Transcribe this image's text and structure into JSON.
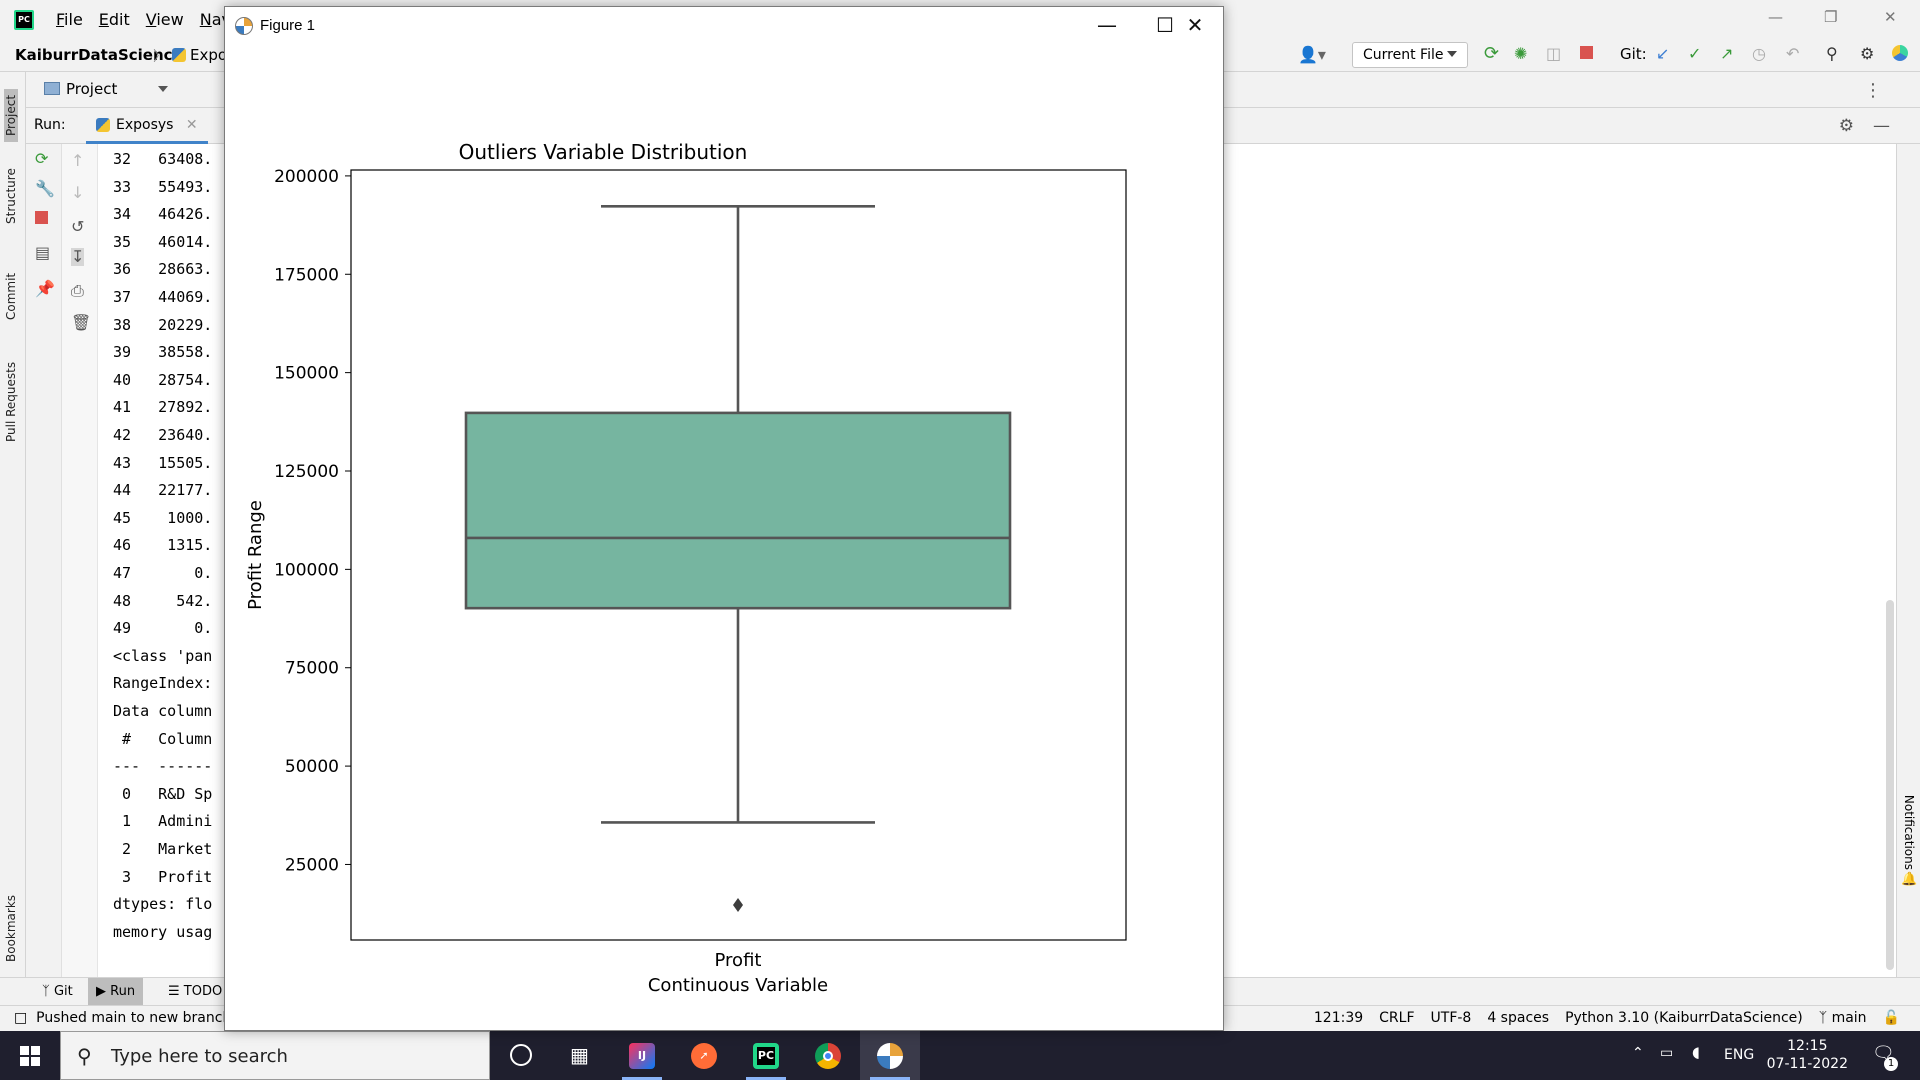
{
  "ide": {
    "menu": [
      "File",
      "Edit",
      "View",
      "Navig"
    ],
    "project_name": "KaiburrDataScience",
    "file_crumb": "Expo",
    "project_panel_label": "Project",
    "run_label": "Run:",
    "run_tab": "Exposys",
    "current_file_label": "Current File",
    "git_label": "Git:",
    "left_tabs": [
      "Project",
      "Structure",
      "Commit",
      "Pull Requests",
      "Bookmarks"
    ],
    "right_tabs": [
      "Notifications"
    ],
    "bottom_tabs": [
      "Git",
      "Run",
      "TODO"
    ],
    "status_message": "Pushed main to new branch o",
    "status_right": [
      "121:39",
      "CRLF",
      "UTF-8",
      "4 spaces",
      "Python 3.10 (KaiburrDataScience)",
      "main"
    ]
  },
  "console": {
    "lines": [
      "32   63408.",
      "33   55493.",
      "34   46426.",
      "35   46014.",
      "36   28663.",
      "37   44069.",
      "38   20229.",
      "39   38558.",
      "40   28754.",
      "41   27892.",
      "42   23640.",
      "43   15505.",
      "44   22177.",
      "45    1000.",
      "46    1315.",
      "47       0.",
      "48     542.",
      "49       0.",
      "<class 'pan",
      "RangeIndex:",
      "Data column",
      " #   Column",
      "---  ------",
      " 0   R&D Sp",
      " 1   Admini",
      " 2   Market",
      " 3   Profit",
      "dtypes: flo",
      "memory usag"
    ]
  },
  "figure": {
    "window_title": "Figure 1"
  },
  "chart_data": {
    "type": "box",
    "title": "Outliers Variable Distribution",
    "xlabel": "Continuous Variable",
    "ylabel": "Profit Range",
    "categories": [
      "Profit"
    ],
    "box": {
      "whisker_low": 35673,
      "q1": 90138,
      "median": 107978,
      "q3": 139766,
      "whisker_high": 192262,
      "outliers": [
        14681
      ]
    },
    "ylim": [
      5000,
      200000
    ],
    "yticks": [
      25000,
      50000,
      75000,
      100000,
      125000,
      150000,
      175000,
      200000
    ],
    "box_color": "#76b5a0",
    "grid": false
  },
  "taskbar": {
    "search_placeholder": "Type here to search",
    "language": "ENG",
    "time": "12:15",
    "date": "07-11-2022",
    "notification_count": "1"
  }
}
